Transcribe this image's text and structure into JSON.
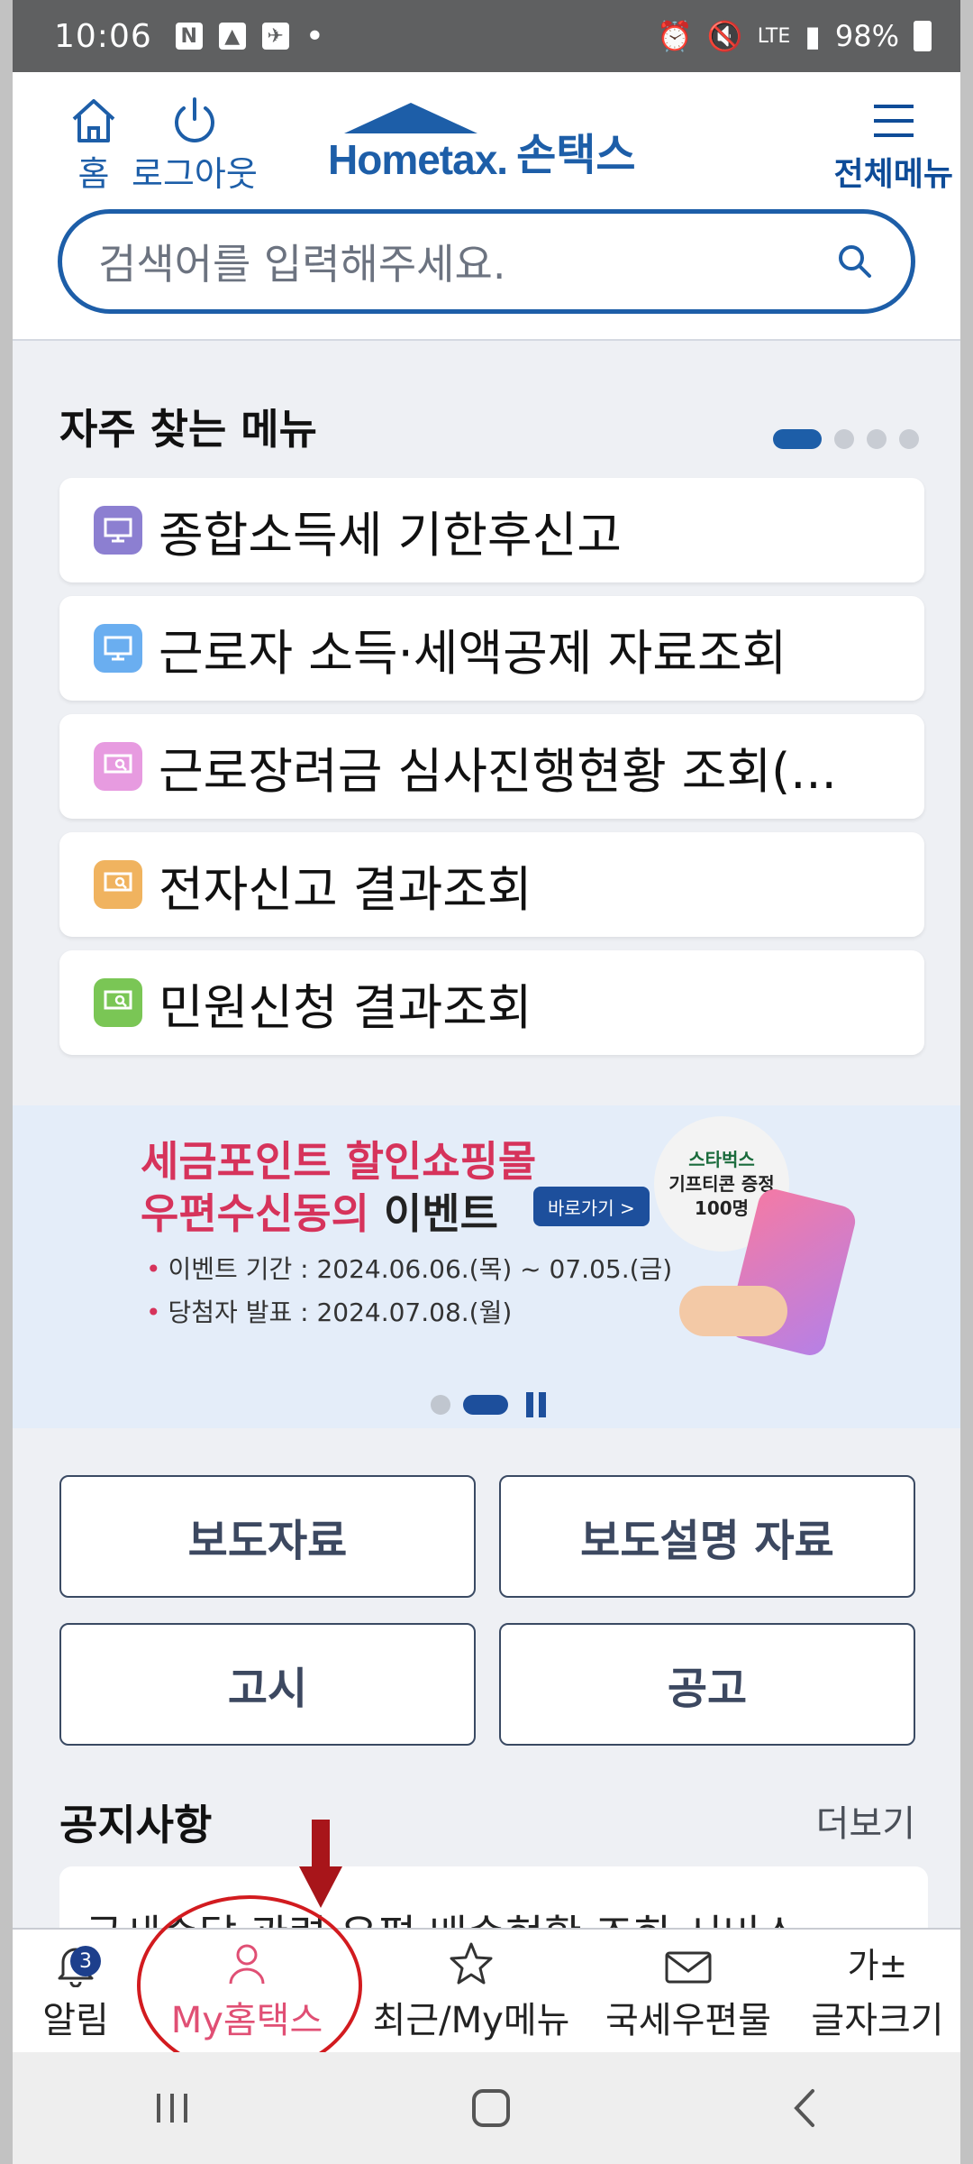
{
  "status_bar": {
    "time": "10:06",
    "battery": "98%",
    "network": "LTE"
  },
  "header": {
    "home_label": "홈",
    "logout_label": "로그아웃",
    "logo_text": "Hometax.",
    "logo_korean": "손택스",
    "menu_label": "전체메뉴"
  },
  "search": {
    "placeholder": "검색어를 입력해주세요."
  },
  "frequent": {
    "title": "자주 찾는 메뉴",
    "items": [
      {
        "label": "종합소득세 기한후신고",
        "icon_color": "#8c7fd1",
        "icon": "monitor-icon"
      },
      {
        "label": "근로자 소득·세액공제 자료조회",
        "icon_color": "#6aaef0",
        "icon": "monitor-icon"
      },
      {
        "label": "근로장려금 심사진행현황 조회(...",
        "icon_color": "#e79be0",
        "icon": "monitor-search-icon"
      },
      {
        "label": "전자신고 결과조회",
        "icon_color": "#f0b35f",
        "icon": "monitor-search-icon"
      },
      {
        "label": "민원신청 결과조회",
        "icon_color": "#7ac655",
        "icon": "monitor-search-icon"
      }
    ]
  },
  "banner": {
    "line1": "세금포인트 할인쇼핑몰",
    "line2_red": "우편수신동의",
    "line2_dark": " 이벤트",
    "goto_label": "바로가기 >",
    "period": "이벤트 기간 : 2024.06.06.(목) ~ 07.05.(금)",
    "announce": "당첨자 발표 : 2024.07.08.(월)",
    "badge_line1": "스타벅스",
    "badge_line2": "기프티콘 증정",
    "badge_line3": "100명"
  },
  "buttons": {
    "press": "보도자료",
    "press_explain": "보도설명 자료",
    "notice_gov": "고시",
    "announcement": "공고"
  },
  "notice": {
    "title": "공지사항",
    "more": "더보기",
    "first_item": "국세송달 관련 우편 배송현황 조회 서비스"
  },
  "tabbar": {
    "tabs": [
      {
        "label": "알림",
        "badge": "3"
      },
      {
        "label": "My홈택스"
      },
      {
        "label": "최근/My메뉴"
      },
      {
        "label": "국세우편물"
      },
      {
        "label": "글자크기",
        "icon_text": "가±"
      }
    ]
  },
  "colors": {
    "brand": "#1d5ea8",
    "accent_pink": "#e04f74",
    "annotation_red": "#d21b1f"
  }
}
